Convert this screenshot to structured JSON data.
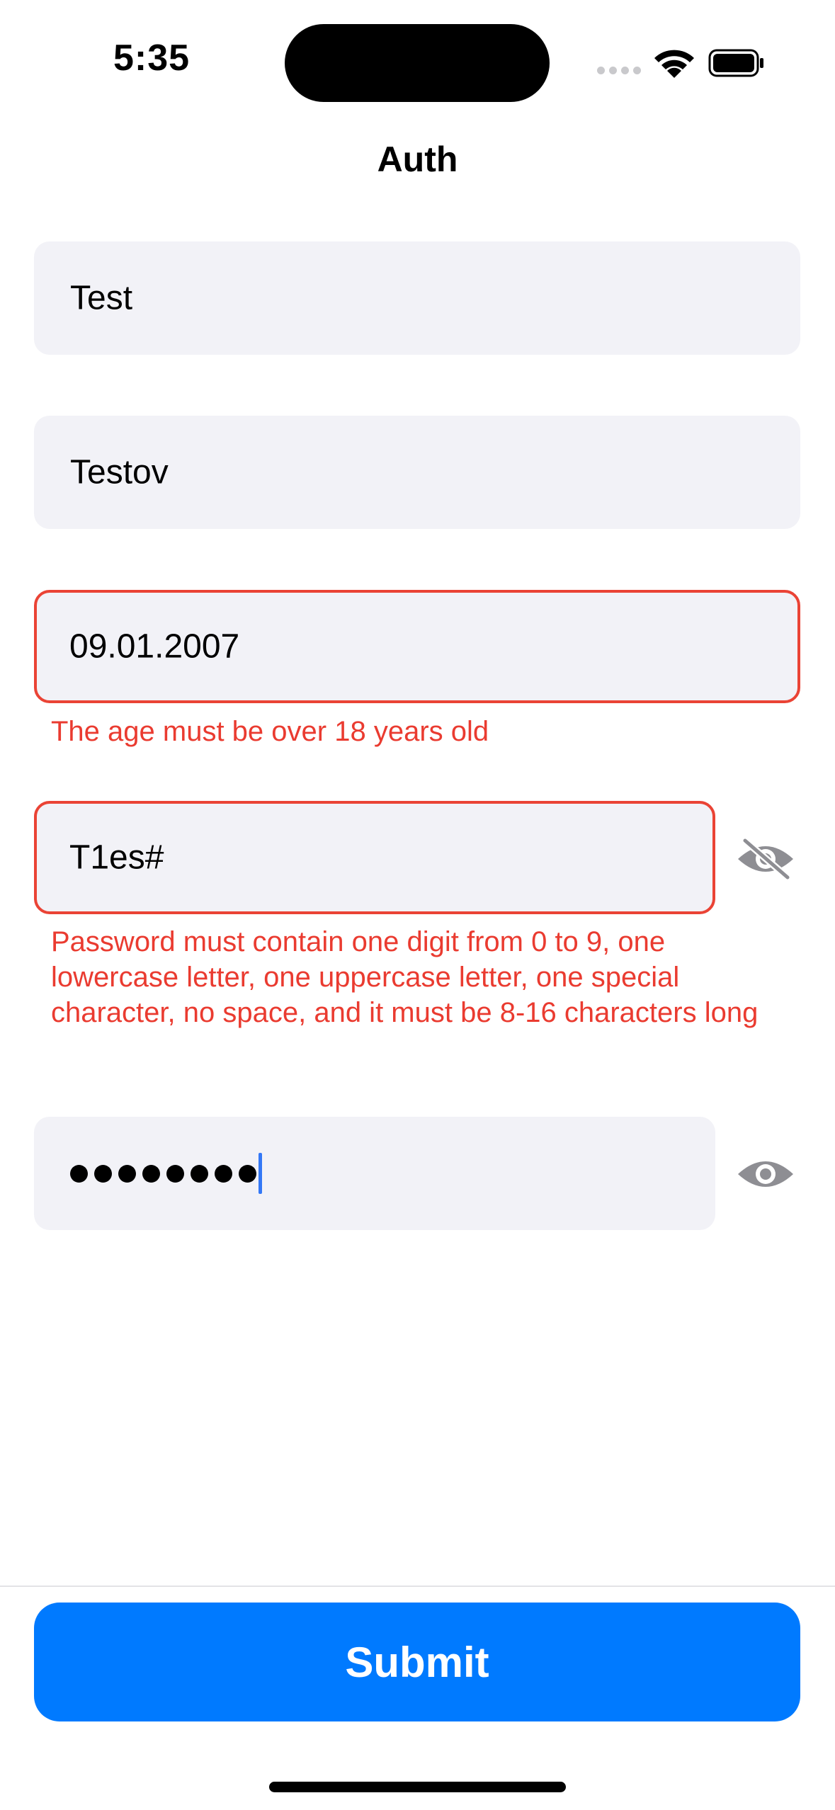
{
  "status_bar": {
    "time": "5:35",
    "icons": [
      "cellular-signal-icon",
      "wifi-icon",
      "battery-icon"
    ]
  },
  "nav": {
    "title": "Auth"
  },
  "form": {
    "first_name": {
      "value": "Test"
    },
    "last_name": {
      "value": "Testov"
    },
    "birth_date": {
      "value": "09.01.2007",
      "error": "The age must be over 18 years old"
    },
    "password": {
      "value": "T1es#",
      "visibility_icon": "eye-slash-icon",
      "error": "Password must contain one digit from 0 to 9, one lowercase letter, one uppercase letter, one special character, no space, and it must be 8-16 characters long"
    },
    "confirm_password": {
      "masked_length": 8,
      "visibility_icon": "eye-icon"
    }
  },
  "submit": {
    "label": "Submit"
  },
  "colors": {
    "accent": "#007aff",
    "error": "#ea3b30",
    "field_background": "#f2f2f7"
  }
}
